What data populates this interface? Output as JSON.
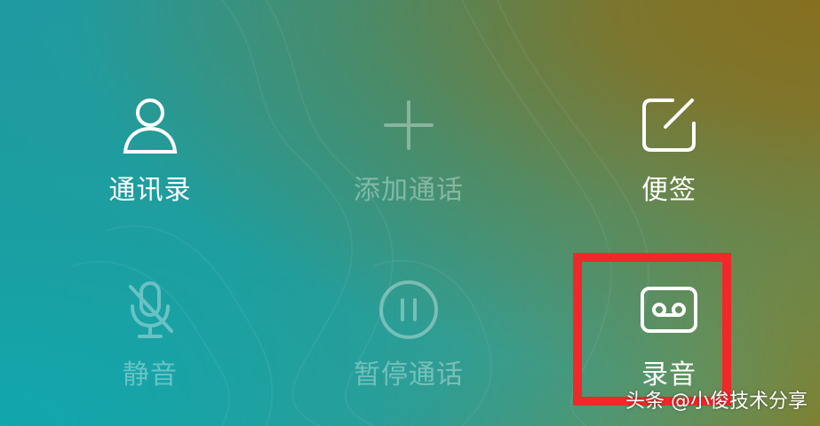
{
  "buttons": {
    "contacts": {
      "label": "通讯录",
      "icon": "person-icon",
      "enabled": true
    },
    "add_call": {
      "label": "添加通话",
      "icon": "plus-icon",
      "enabled": false
    },
    "notes": {
      "label": "便签",
      "icon": "edit-note-icon",
      "enabled": true
    },
    "mute": {
      "label": "静音",
      "icon": "mic-off-icon",
      "enabled": false
    },
    "hold": {
      "label": "暂停通话",
      "icon": "pause-icon",
      "enabled": false
    },
    "record": {
      "label": "录音",
      "icon": "cassette-tape-icon",
      "enabled": true
    }
  },
  "highlight_color": "#f0282a",
  "watermark": {
    "text": "头条 @小俊技术分享"
  }
}
